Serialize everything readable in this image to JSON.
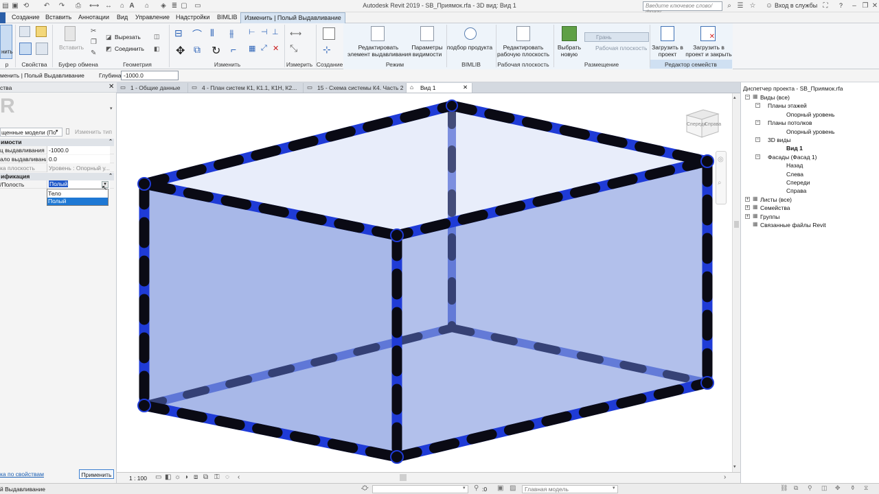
{
  "app": {
    "title": "Autodesk Revit 2019 - SB_Приямок.rfa - 3D вид: Вид 1",
    "search_placeholder": "Введите ключевое слово/фразу",
    "signin": "Вход в службы",
    "help": "?"
  },
  "ribbon_tabs": [
    "Создание",
    "Вставить",
    "Аннотации",
    "Вид",
    "Управление",
    "Надстройки",
    "BIMLIB",
    "Изменить | Полый Выдавливание"
  ],
  "ribbon": {
    "modify_label": "нить",
    "paste_label": "Вставить",
    "cut_label": "Вырезать",
    "join_label": "Соединить",
    "panels": {
      "select": "р",
      "properties": "Свойства",
      "clipboard": "Буфер обмена",
      "geometry": "Геометрия",
      "modify": "Изменить",
      "measure": "Измерить",
      "create": "Создание",
      "mode": "Режим",
      "bimlib": "BIMLIB",
      "workplane": "Рабочая плоскость",
      "placement": "Размещение",
      "family_editor": "Редактор семейств"
    },
    "buttons": {
      "edit_extrusion": "Редактировать\nэлемент выдавливания",
      "visibility_params": "Параметры\nвидимости",
      "product_selection": "подбор продукта",
      "edit_workplane": "Редактировать\nрабочую плоскость",
      "pick_new": "Выбрать\nновую",
      "face": "Грань",
      "work_plane": "Рабочая плоскость",
      "load_into_project": "Загрузить в\nпроект",
      "load_into_project_close": "Загрузить в\nпроект и закрыть"
    }
  },
  "options_bar": {
    "context": "менить | Полый Выдавливание",
    "depth_label": "Глубина",
    "depth_value": "-1000.0"
  },
  "properties": {
    "title": "ства",
    "type_selector": "щенные модели (По",
    "edit_type": "Изменить тип",
    "groups": [
      "имости",
      "ификация"
    ],
    "rows": [
      {
        "key": "ц выдавливания",
        "value": "-1000.0"
      },
      {
        "key": "ало выдавливания",
        "value": "0.0"
      },
      {
        "key": "ка плоскость",
        "value": "Уровень : Опорный у..."
      },
      {
        "key": "/Полость",
        "value": "Полый"
      }
    ],
    "dropdown_options": [
      "Тело",
      "Полый"
    ],
    "help_link": "ка по свойствам",
    "apply": "Применить"
  },
  "view_tabs": [
    {
      "label": "1 - Общие данные"
    },
    {
      "label": "4 - План систем К1, К1.1, К1Н, К2..."
    },
    {
      "label": "15 - Схема системы К4. Часть 2"
    },
    {
      "label": "Вид 1"
    }
  ],
  "viewcube": {
    "front": "Спереди",
    "right": "Справа"
  },
  "view_bar": {
    "scale": "1 : 100"
  },
  "browser": {
    "title": "Диспетчер проекта - SB_Приямок.rfa",
    "nodes": [
      {
        "label": "Виды (все)",
        "level": 0,
        "expander": "−"
      },
      {
        "label": "Планы этажей",
        "level": 1,
        "expander": "−"
      },
      {
        "label": "Опорный уровень",
        "level": 2,
        "expander": ""
      },
      {
        "label": "Планы потолков",
        "level": 1,
        "expander": "−"
      },
      {
        "label": "Опорный уровень",
        "level": 2,
        "expander": ""
      },
      {
        "label": "3D виды",
        "level": 1,
        "expander": "−"
      },
      {
        "label": "Вид 1",
        "level": 2,
        "expander": "",
        "bold": true
      },
      {
        "label": "Фасады (Фасад 1)",
        "level": 1,
        "expander": "−"
      },
      {
        "label": "Назад",
        "level": 2,
        "expander": ""
      },
      {
        "label": "Слева",
        "level": 2,
        "expander": ""
      },
      {
        "label": "Спереди",
        "level": 2,
        "expander": ""
      },
      {
        "label": "Справа",
        "level": 2,
        "expander": ""
      },
      {
        "label": "Листы (все)",
        "level": 0,
        "expander": "+"
      },
      {
        "label": "Семейства",
        "level": 0,
        "expander": "+"
      },
      {
        "label": "Группы",
        "level": 0,
        "expander": "+"
      },
      {
        "label": "Связанные файлы Revit",
        "level": 0,
        "expander": ""
      }
    ]
  },
  "status": {
    "text": "й Выдавливание",
    "coord": ":0",
    "main_model": "Главная модель"
  },
  "colors": {
    "accent": "#1f3bd6",
    "pipe_dark": "#0a0a14",
    "face_fill": "#9fb0e6"
  }
}
